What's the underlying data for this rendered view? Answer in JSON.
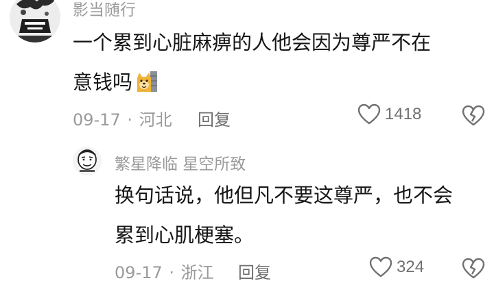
{
  "comments": [
    {
      "username": "影当随行",
      "text_line1": "一个累到心脏麻痹的人他会因为尊严不在",
      "text_line2": "意钱吗",
      "emoji": "doge-icon",
      "date": "09-17",
      "location": "河北",
      "reply_label": "回复",
      "likes": "1418"
    },
    {
      "username": "繁星降临  星空所致",
      "text_line1": "换句话说，他但凡不要这尊严，也不会",
      "text_line2": "累到心肌梗塞。",
      "date": "09-17",
      "location": "浙江",
      "reply_label": "回复",
      "likes": "324"
    }
  ],
  "separator": "·",
  "colors": {
    "meta": "#9a9a9a",
    "text": "#161616",
    "icon": "#6f6f6f"
  }
}
